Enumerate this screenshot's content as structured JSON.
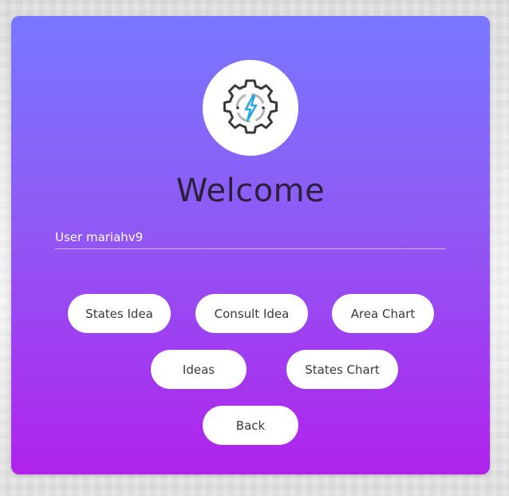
{
  "header": {
    "title": "Welcome",
    "logo_icon": "gear-lightning-icon"
  },
  "user": {
    "label": "User mariahv9"
  },
  "buttons": {
    "states_idea": "States Idea",
    "consult_idea": "Consult Idea",
    "area_chart": "Area Chart",
    "ideas": "Ideas",
    "states_chart": "States Chart",
    "back": "Back"
  },
  "colors": {
    "gradient_top": "#7777ff",
    "gradient_bottom": "#b022ec",
    "icon_accent": "#29a8e0",
    "icon_dark": "#3a3a3a"
  }
}
